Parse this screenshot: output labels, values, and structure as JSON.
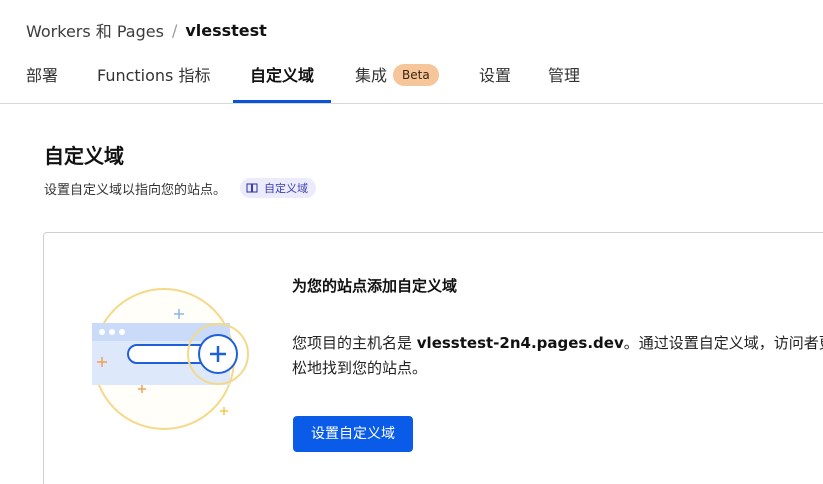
{
  "breadcrumb": {
    "parent": "Workers 和 Pages",
    "separator": "/",
    "current": "vlesstest"
  },
  "tabs": [
    {
      "label": "部署"
    },
    {
      "label": "Functions 指标"
    },
    {
      "label": "自定义域",
      "active": true
    },
    {
      "label": "集成",
      "badge": "Beta"
    },
    {
      "label": "设置"
    },
    {
      "label": "管理"
    }
  ],
  "section": {
    "title": "自定义域",
    "description": "设置自定义域以指向您的站点。",
    "doc_link_label": "自定义域",
    "doc_link_icon": "book-icon"
  },
  "card": {
    "title": "为您的站点添加自定义域",
    "text_before": "您项目的主机名是 ",
    "hostname": "vlesstest-2n4.pages.dev",
    "text_after": "。通过设置自定义域，访问者更轻松地找到您的站点。",
    "button_label": "设置自定义域",
    "illustration_icon": "add-domain-illustration"
  },
  "colors": {
    "accent": "#0a52d6",
    "primary_button": "#0a5ce8",
    "beta_badge": "#f7c59a",
    "doc_chip_bg": "#ecebfb",
    "illustration_yellow": "#f5d98a",
    "illustration_blue": "#1f5fd8"
  }
}
